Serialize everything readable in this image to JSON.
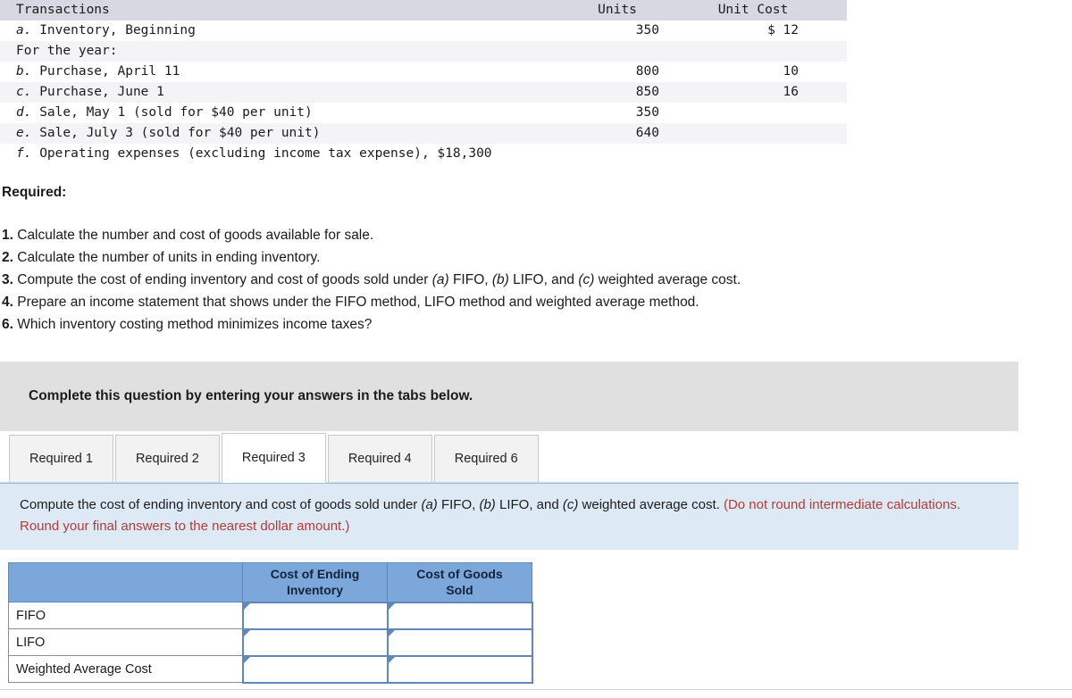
{
  "transactions_table": {
    "columns": [
      "Transactions",
      "Units",
      "Unit Cost"
    ],
    "rows": [
      {
        "letter": "a.",
        "desc": "Inventory, Beginning",
        "units": "350",
        "cost": "$ 12",
        "shaded": false
      },
      {
        "letter": "",
        "desc": "For the year:",
        "units": "",
        "cost": "",
        "shaded": true
      },
      {
        "letter": "b.",
        "desc": "Purchase, April 11",
        "units": "800",
        "cost": "10",
        "shaded": false
      },
      {
        "letter": "c.",
        "desc": "Purchase, June 1",
        "units": "850",
        "cost": "16",
        "shaded": true
      },
      {
        "letter": "d.",
        "desc": "Sale, May 1 (sold for $40 per unit)",
        "units": "350",
        "cost": "",
        "shaded": false
      },
      {
        "letter": "e.",
        "desc": "Sale, July 3 (sold for $40 per unit)",
        "units": "640",
        "cost": "",
        "shaded": true
      },
      {
        "letter": "f.",
        "desc": "Operating expenses (excluding income tax expense), $18,300",
        "units": "",
        "cost": "",
        "shaded": false
      }
    ]
  },
  "required": {
    "heading": "Required:",
    "items": [
      {
        "num": "1.",
        "parts": [
          {
            "t": " Calculate the number and cost of goods available for sale.",
            "i": false
          }
        ]
      },
      {
        "num": "2.",
        "parts": [
          {
            "t": " Calculate the number of units in ending inventory.",
            "i": false
          }
        ]
      },
      {
        "num": "3.",
        "parts": [
          {
            "t": " Compute the cost of ending inventory and cost of goods sold under ",
            "i": false
          },
          {
            "t": "(a)",
            "i": true
          },
          {
            "t": " FIFO, ",
            "i": false
          },
          {
            "t": "(b)",
            "i": true
          },
          {
            "t": " LIFO, and ",
            "i": false
          },
          {
            "t": "(c)",
            "i": true
          },
          {
            "t": " weighted average cost.",
            "i": false
          }
        ]
      },
      {
        "num": "4.",
        "parts": [
          {
            "t": " Prepare an income statement that shows under the FIFO method, LIFO method and weighted average method.",
            "i": false
          }
        ]
      },
      {
        "num": "6.",
        "parts": [
          {
            "t": " Which inventory costing method minimizes income taxes?",
            "i": false
          }
        ]
      }
    ]
  },
  "banner": {
    "text": "Complete this question by entering your answers in the tabs below."
  },
  "tabs": {
    "items": [
      {
        "label": "Required 1",
        "active": false
      },
      {
        "label": "Required 2",
        "active": false
      },
      {
        "label": "Required 3",
        "active": true
      },
      {
        "label": "Required 4",
        "active": false
      },
      {
        "label": "Required 6",
        "active": false
      }
    ]
  },
  "prompt": {
    "segments": [
      {
        "t": "Compute the cost of ending inventory and cost of goods sold under ",
        "red": false,
        "ital": false
      },
      {
        "t": "(a)",
        "red": false,
        "ital": true
      },
      {
        "t": " FIFO, ",
        "red": false,
        "ital": false
      },
      {
        "t": "(b)",
        "red": false,
        "ital": true
      },
      {
        "t": " LIFO, and ",
        "red": false,
        "ital": false
      },
      {
        "t": "(c)",
        "red": false,
        "ital": true
      },
      {
        "t": " weighted average cost. ",
        "red": false,
        "ital": false
      },
      {
        "t": "(Do not round intermediate calculations. Round your final answers to the nearest dollar amount.)",
        "red": true,
        "ital": false
      }
    ]
  },
  "answer_table": {
    "headers": [
      "",
      "Cost of Ending Inventory",
      "Cost of Goods Sold"
    ],
    "header_lines": [
      [
        ""
      ],
      [
        "Cost of Ending",
        "Inventory"
      ],
      [
        "Cost of Goods",
        "Sold"
      ]
    ],
    "rows": [
      {
        "label": "FIFO",
        "ending_inventory": "",
        "cogs": ""
      },
      {
        "label": "LIFO",
        "ending_inventory": "",
        "cogs": ""
      },
      {
        "label": "Weighted Average Cost",
        "ending_inventory": "",
        "cogs": ""
      }
    ]
  },
  "colors": {
    "table_header_gray": "#d6d9e1",
    "row_shade": "#f4f4f6",
    "banner_gray": "#e0e0e0",
    "prompt_blue": "#ddeaf6",
    "answer_header_blue": "#7ba7db",
    "prompt_red": "#b23b36",
    "input_border_blue": "#5f88b8"
  }
}
